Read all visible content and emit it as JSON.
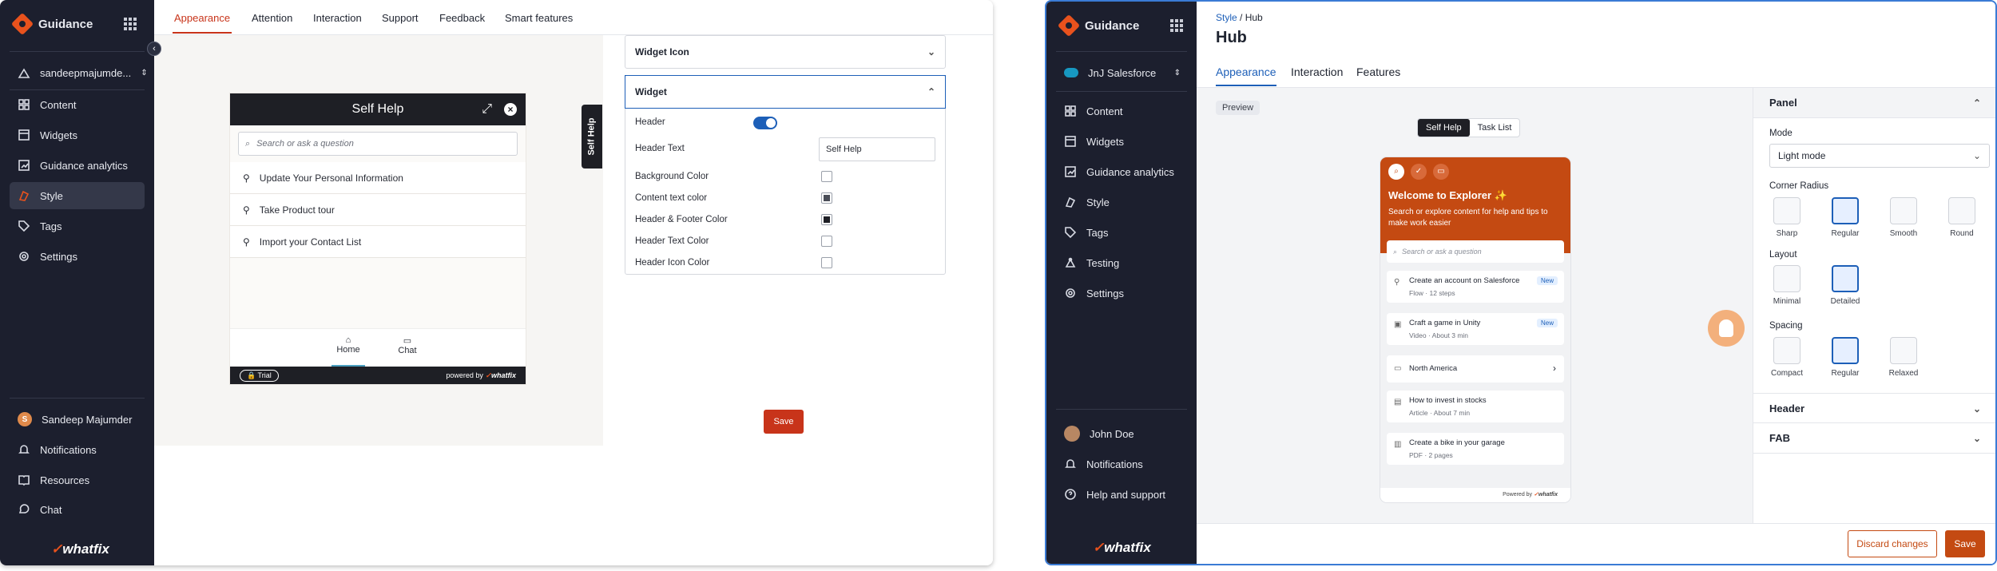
{
  "left": {
    "brand": "Guidance",
    "account": "sandeepmajumde...",
    "nav": [
      "Content",
      "Widgets",
      "Guidance analytics",
      "Style",
      "Tags",
      "Settings"
    ],
    "active_nav": "Style",
    "bottom_nav": [
      "Sandeep Majumder",
      "Notifications",
      "Resources",
      "Chat"
    ],
    "user_initial": "S",
    "logo_text": "whatfix",
    "tabs": [
      "Appearance",
      "Attention",
      "Interaction",
      "Support",
      "Feedback",
      "Smart features"
    ],
    "active_tab": "Appearance",
    "widget": {
      "title": "Self Help",
      "search_placeholder": "Search or ask a question",
      "items": [
        "Update Your Personal Information",
        "Take Product tour",
        "Import your Contact List"
      ],
      "footer_tabs": [
        "Home",
        "Chat"
      ],
      "trial": "Trial",
      "powered_by": "powered by",
      "side_tab": "Self Help"
    },
    "accordion": {
      "widget_icon": "Widget Icon",
      "widget": "Widget",
      "rows": {
        "header": "Header",
        "header_text": "Header Text",
        "header_text_value": "Self Help",
        "background_color": "Background Color",
        "content_text_color": "Content text color",
        "header_footer_color": "Header & Footer Color",
        "header_text_color": "Header Text Color",
        "header_icon_color": "Header Icon Color"
      },
      "header_toggle_on": true
    },
    "save_label": "Save"
  },
  "right": {
    "brand": "Guidance",
    "account": "JnJ Salesforce",
    "nav": [
      "Content",
      "Widgets",
      "Guidance analytics",
      "Style",
      "Tags",
      "Testing",
      "Settings"
    ],
    "bottom_nav": [
      "John Doe",
      "Notifications",
      "Help and support"
    ],
    "logo_text": "whatfix",
    "breadcrumb_parent": "Style",
    "breadcrumb_sep": "/",
    "breadcrumb_current": "Hub",
    "title": "Hub",
    "tabs": [
      "Appearance",
      "Interaction",
      "Features"
    ],
    "active_tab": "Appearance",
    "preview_chip": "Preview",
    "segments": [
      "Self Help",
      "Task List"
    ],
    "hub": {
      "welcome": "Welcome to Explorer ✨",
      "subtitle": "Search or explore content for help and tips to make work easier",
      "search_placeholder": "Search or ask a question",
      "cards": [
        {
          "title": "Create an account on Salesforce",
          "sub": "Flow · 12 steps",
          "badge": "New"
        },
        {
          "title": "Craft a game in Unity",
          "sub": "Video · About 3 min",
          "badge": "New"
        },
        {
          "title": "North America",
          "sub": "",
          "badge": ""
        },
        {
          "title": "How to invest in stocks",
          "sub": "Article · About 7 min",
          "badge": ""
        },
        {
          "title": "Create a bike in your garage",
          "sub": "PDF · 2 pages",
          "badge": ""
        }
      ],
      "powered_by": "Powered by"
    },
    "panel": {
      "title": "Panel",
      "mode_label": "Mode",
      "mode_value": "Light mode",
      "corner_label": "Corner Radius",
      "corner_options": [
        "Sharp",
        "Regular",
        "Smooth",
        "Round"
      ],
      "corner_selected": "Regular",
      "layout_label": "Layout",
      "layout_options": [
        "Minimal",
        "Detailed"
      ],
      "layout_selected": "Detailed",
      "spacing_label": "Spacing",
      "spacing_options": [
        "Compact",
        "Regular",
        "Relaxed"
      ],
      "spacing_selected": "Regular"
    },
    "sections": [
      "Header",
      "FAB"
    ],
    "discard_label": "Discard changes",
    "save_label": "Save"
  },
  "colors": {
    "sidebar_bg": "#1c1f2e",
    "accent_red": "#c8341a",
    "accent_orange": "#c44a12",
    "accent_blue": "#1d5fb8"
  }
}
